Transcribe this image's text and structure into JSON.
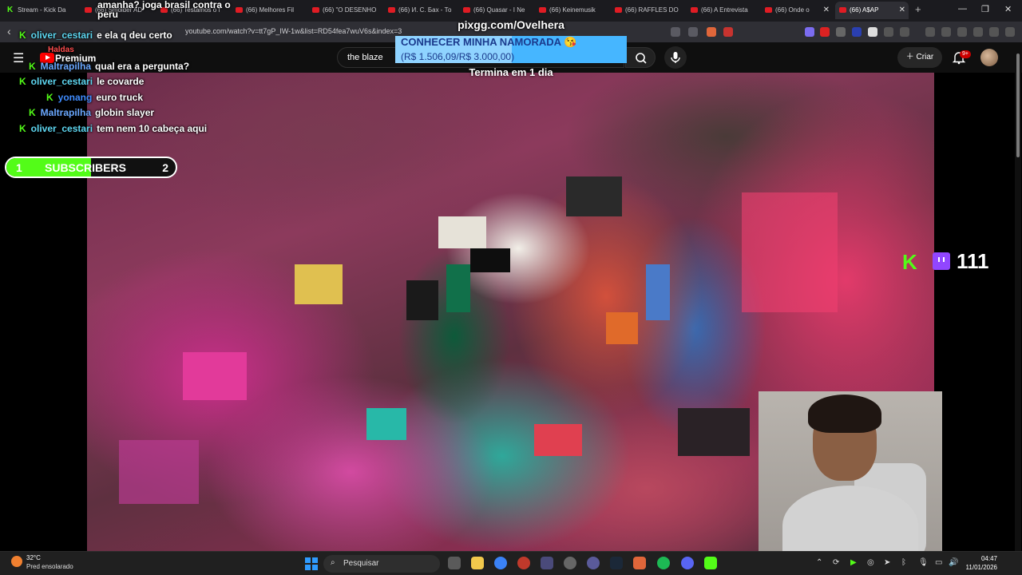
{
  "browser": {
    "tabs": [
      {
        "label": "Stream - Kick Da",
        "icon": "kick-icon",
        "active": false
      },
      {
        "label": "(66) Smolder AD",
        "icon": "youtube-icon",
        "active": false
      },
      {
        "label": "(66) Testamos o f",
        "icon": "youtube-icon",
        "active": false
      },
      {
        "label": "(66) Melhores Fil",
        "icon": "youtube-icon",
        "active": false
      },
      {
        "label": "(66) \"O DESENHO",
        "icon": "youtube-icon",
        "active": false
      },
      {
        "label": "(66) И. С. Бах - То",
        "icon": "youtube-icon",
        "active": false
      },
      {
        "label": "(66) Quasar - I Ne",
        "icon": "youtube-icon",
        "active": false
      },
      {
        "label": "(66) Keinemusik",
        "icon": "youtube-icon",
        "active": false
      },
      {
        "label": "(66) RAFFLES DO",
        "icon": "youtube-icon",
        "active": false
      },
      {
        "label": "(66) A Entrevista",
        "icon": "youtube-icon",
        "active": false
      },
      {
        "label": "(66) Onde o",
        "icon": "youtube-icon",
        "active": false
      },
      {
        "label": "(66) A$AP",
        "icon": "youtube-icon",
        "active": true
      }
    ],
    "url": "youtube.com/watch?v=tt7gP_IW-1w&list=RD54fea7wuV6s&index=3"
  },
  "youtube": {
    "logo_text": "Premium",
    "search_value": "the blaze",
    "create_label": "Criar",
    "notification_count": "9+"
  },
  "overlay": {
    "chat_question": "amanha? joga brasil contra o peru",
    "chat": [
      {
        "user": "oliver_cestari",
        "color": "#5dd6f0",
        "message": "e ela q deu certo"
      },
      {
        "user": "Haldas",
        "color": "#ff4d4d",
        "message": ""
      },
      {
        "user": "Maltrapilha",
        "color": "#6aa8ff",
        "message": "qual era a pergunta?"
      },
      {
        "user": "oliver_cestari",
        "color": "#5dd6f0",
        "message": "le covarde"
      },
      {
        "user": "yonang",
        "color": "#3f8cff",
        "message": "euro truck"
      },
      {
        "user": "Maltrapilha",
        "color": "#6aa8ff",
        "message": "globin slayer"
      },
      {
        "user": "oliver_cestari",
        "color": "#5dd6f0",
        "message": "tem nem 10 cabeça aqui"
      }
    ],
    "pix_url": "pixgg.com/Ovelhera",
    "donation_title": "CONHECER MINHA NAMORADA",
    "donation_amount": "(R$ 1.506,09/R$ 3.000,00)",
    "donation_progress": 0.502,
    "ends_in": "Termina em 1 dia",
    "subscribers": {
      "current": "1",
      "label": "SUBSCRIBERS",
      "target": "2",
      "progress": 0.5
    },
    "viewer_count": "111",
    "accent_green": "#53fc18"
  },
  "taskbar": {
    "weather_temp": "32°C",
    "weather_desc": "Pred ensolarado",
    "search_label": "Pesquisar",
    "time": "04:47",
    "date": "11/01/2026"
  }
}
